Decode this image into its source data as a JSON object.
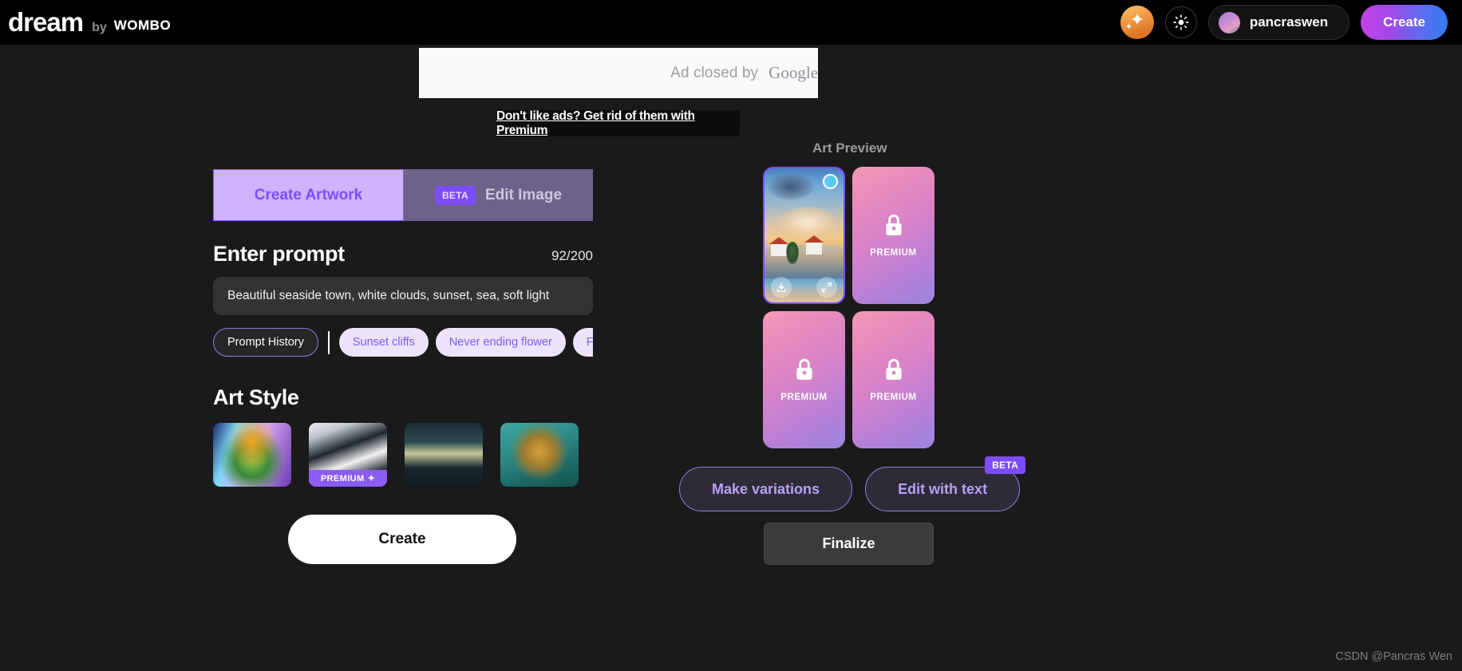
{
  "header": {
    "logo_main": "dream",
    "logo_by": "by",
    "logo_brand": "WOMBO",
    "sparkle_icon": "sparkle-avatar-icon",
    "theme_icon": "sun-brightness-icon",
    "username": "pancraswen",
    "create_label": "Create"
  },
  "ad": {
    "closed_text": "Ad closed by ",
    "google_text": "Google",
    "premium_link": "Don't like ads? Get rid of them with Premium"
  },
  "tabs": [
    {
      "label": "Create Artwork",
      "active": true,
      "badge": ""
    },
    {
      "label": "Edit Image",
      "active": false,
      "badge": "BETA"
    }
  ],
  "prompt": {
    "title": "Enter prompt",
    "counter": "92/200",
    "value": "Beautiful seaside town, white clouds, sunset, sea, soft light",
    "placeholder": "Enter prompt"
  },
  "chips": {
    "history_label": "Prompt History",
    "suggestions": [
      "Sunset cliffs",
      "Never ending flower",
      "Fire and w"
    ]
  },
  "art_style": {
    "title": "Art Style",
    "thumbs": [
      {
        "name": "style-thumb-1",
        "premium": false,
        "badge": ""
      },
      {
        "name": "style-thumb-2",
        "premium": true,
        "badge": "PREMIUM"
      },
      {
        "name": "style-thumb-3",
        "premium": false,
        "badge": ""
      },
      {
        "name": "style-thumb-4",
        "premium": false,
        "badge": ""
      }
    ]
  },
  "create_main_label": "Create",
  "preview": {
    "title": "Art Preview",
    "cards": [
      {
        "type": "generated",
        "selected": true,
        "label": ""
      },
      {
        "type": "premium",
        "selected": false,
        "label": "PREMIUM"
      },
      {
        "type": "premium",
        "selected": false,
        "label": "PREMIUM"
      },
      {
        "type": "premium",
        "selected": false,
        "label": "PREMIUM"
      }
    ]
  },
  "actions": {
    "make_variations": "Make variations",
    "edit_with_text": "Edit with text",
    "edit_badge": "BETA",
    "finalize": "Finalize"
  },
  "watermark": "CSDN @Pancras Wen",
  "colors": {
    "accent_purple": "#7c4dff",
    "tab_active_bg": "#cdb4fd",
    "page_bg": "#1a1a1a",
    "header_bg": "#000000"
  }
}
